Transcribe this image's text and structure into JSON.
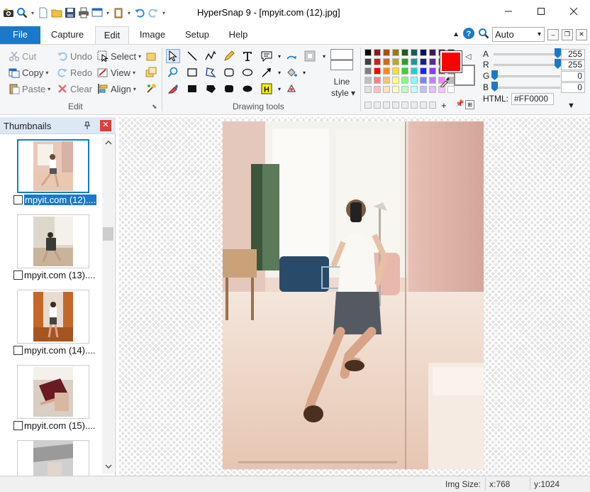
{
  "window": {
    "title": "HyperSnap 9 - [mpyit.com (12).jpg]"
  },
  "tabs": [
    {
      "label": "File"
    },
    {
      "label": "Capture"
    },
    {
      "label": "Edit"
    },
    {
      "label": "Image"
    },
    {
      "label": "Setup"
    },
    {
      "label": "Help"
    }
  ],
  "zoom_select": "Auto",
  "edit_group": {
    "cut": "Cut",
    "copy": "Copy",
    "paste": "Paste",
    "undo": "Undo",
    "redo": "Redo",
    "clear": "Clear",
    "select": "Select",
    "view": "View",
    "align": "Align",
    "label": "Edit"
  },
  "drawing_group": {
    "label": "Drawing tools",
    "line_style_line1": "Line",
    "line_style_line2": "style"
  },
  "color": {
    "current_hex": "#FF0000",
    "a_label": "A",
    "r_label": "R",
    "g_label": "G",
    "b_label": "B",
    "a": "255",
    "r": "255",
    "g": "0",
    "b": "0",
    "html_label": "HTML:",
    "html_value": "#FF0000",
    "palette": [
      "#000000",
      "#8b1a1a",
      "#ae4e12",
      "#9a7a10",
      "#1c5c1c",
      "#116060",
      "#101060",
      "#3a1a5a",
      "#551a55",
      "#333333",
      "#404040",
      "#cc2020",
      "#d86818",
      "#c8a81a",
      "#2aa02a",
      "#1a9a9a",
      "#1a1aa0",
      "#5a2a9a",
      "#8a2a8a",
      "#666666",
      "#808080",
      "#ff0000",
      "#ff8c1a",
      "#ffe01a",
      "#3ad03a",
      "#20d0d0",
      "#2020ff",
      "#8040ff",
      "#e020e0",
      "#999999",
      "#c0c0c0",
      "#ff8080",
      "#ffc080",
      "#ffff80",
      "#80ff80",
      "#80ffff",
      "#8080ff",
      "#c080ff",
      "#ff80ff",
      "#bbbbbb",
      "#e0e0e0",
      "#ffc0c0",
      "#ffe0c0",
      "#ffffc0",
      "#c0ffc0",
      "#c0ffff",
      "#c0c0ff",
      "#e0c0ff",
      "#ffc0ff",
      "#ffffff"
    ]
  },
  "thumbnails": {
    "title": "Thumbnails",
    "items": [
      {
        "label": "mpyit.com (12)...."
      },
      {
        "label": "mpyit.com (13)...."
      },
      {
        "label": "mpyit.com (14)...."
      },
      {
        "label": "mpyit.com (15)...."
      },
      {
        "label": ""
      }
    ]
  },
  "status": {
    "img_size_label": "Img Size:",
    "x": "x:768",
    "y": "y:1024"
  },
  "colors": {
    "accent": "#1979ca",
    "close_red": "#d9413a"
  }
}
